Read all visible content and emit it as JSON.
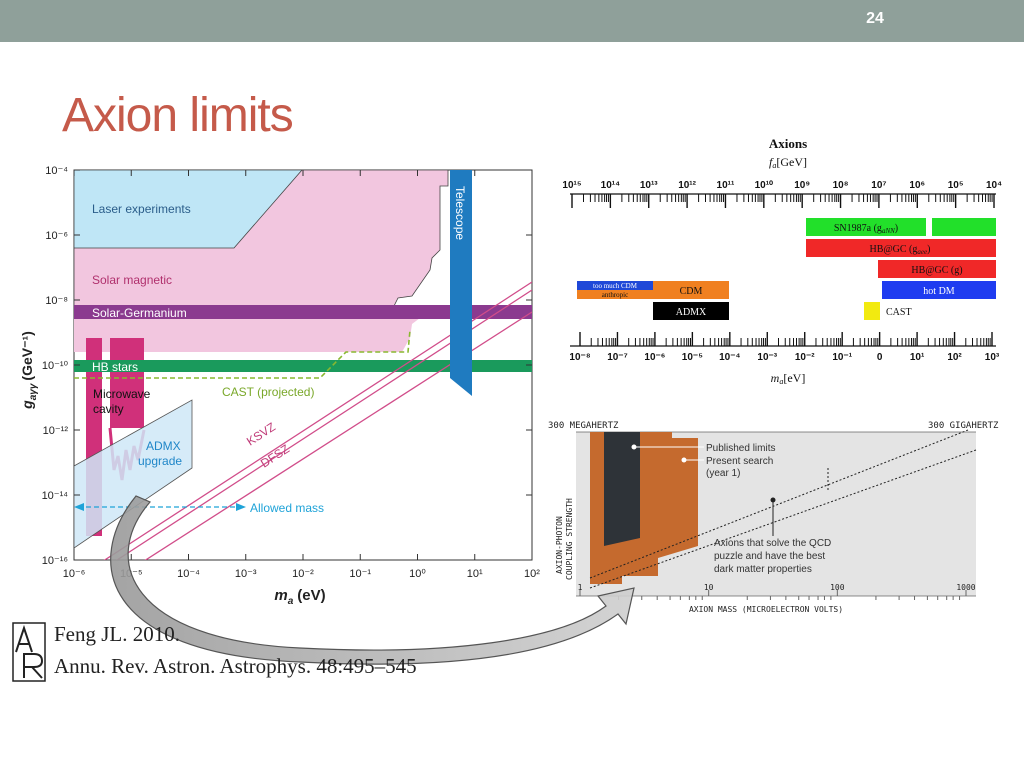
{
  "slide": {
    "number": "24",
    "title": "Axion limits"
  },
  "left_figure": {
    "ylabel": "g",
    "ylabel_sub": "aγγ",
    "ylabel_unit": "(GeV⁻¹)",
    "xlabel": "m",
    "xlabel_sub": "a",
    "xlabel_unit": "(eV)",
    "y_ticks": [
      "10⁻⁴",
      "10⁻⁶",
      "10⁻⁸",
      "10⁻¹⁰",
      "10⁻¹²",
      "10⁻¹⁴",
      "10⁻¹⁶"
    ],
    "x_ticks": [
      "10⁻⁶",
      "10⁻⁵",
      "10⁻⁴",
      "10⁻³",
      "10⁻²",
      "10⁻¹",
      "10⁰",
      "10¹",
      "10²"
    ],
    "regions": {
      "laser": "Laser experiments",
      "solar_magnetic": "Solar magnetic",
      "solar_germanium": "Solar-Germanium",
      "hb_stars": "HB stars",
      "microwave": "Microwave cavity",
      "microwave_l1": "Microwave",
      "microwave_l2": "cavity",
      "admx_l1": "ADMX",
      "admx_l2": "upgrade",
      "telescope": "Telescope",
      "cast": "CAST (projected)",
      "ksvz": "KSVZ",
      "dfsz": "DFSZ",
      "allowed": "Allowed mass"
    },
    "colors": {
      "laser": "#bfe6f6",
      "solar": "#f2c6df",
      "germanium": "#8b3a8f",
      "hb": "#1a9a5c",
      "microwave": "#d0307a",
      "telescope": "#1f7bc0",
      "cast": "#8ab830",
      "allowed": "#1fa3d8"
    }
  },
  "right_chart": {
    "title": "Axions",
    "fa_label": "f",
    "fa_sub": "a",
    "fa_unit": "[GeV]",
    "top_ticks": [
      "10¹⁵",
      "10¹⁴",
      "10¹³",
      "10¹²",
      "10¹¹",
      "10¹⁰",
      "10⁹",
      "10⁸",
      "10⁷",
      "10⁶",
      "10⁵",
      "10⁴"
    ],
    "bottom_ticks": [
      "10⁻⁸",
      "10⁻⁷",
      "10⁻⁶",
      "10⁻⁵",
      "10⁻⁴",
      "10⁻³",
      "10⁻²",
      "10⁻¹",
      "0",
      "10¹",
      "10²",
      "10³"
    ],
    "ma_label": "m",
    "ma_sub": "a",
    "ma_unit": "[eV]",
    "bars": {
      "sn1987a": "SN1987a (g",
      "sn1987a_sub": "aNN",
      "hbgc_e": "HB@GC (g",
      "hbgc_e_sub": "aee",
      "hbgc_g": "HB@GC (g)",
      "hot_dm": "hot DM",
      "cast": "CAST",
      "too_much_cdm": "too much CDM",
      "anthropic": "anthropic",
      "cdm": "CDM",
      "admx": "ADMX"
    },
    "colors": {
      "sn": "#22e02a",
      "hb": "#f02828",
      "hot": "#1f3cf0",
      "cast": "#f2ea10",
      "cdm": "#f08020",
      "admx": "#000000",
      "tmcdm": "#1f48d8"
    }
  },
  "bottom_right_chart": {
    "top_left_label": "300 MEGAHERTZ",
    "top_right_label": "300 GIGAHERTZ",
    "legend_published": "Published limits",
    "legend_present_1": "Present search",
    "legend_present_2": "(year 1)",
    "annotation_1": "Axions that solve the QCD",
    "annotation_2": "puzzle and have the best",
    "annotation_3": "dark matter properties",
    "ylabel_1": "AXION-PHOTON",
    "ylabel_2": "COUPLING STRENGTH",
    "xlabel": "AXION MASS (MICROELECTRON VOLTS)",
    "x_ticks": [
      "1",
      "10",
      "100",
      "1000"
    ],
    "colors": {
      "published": "#2e3338",
      "present": "#c56a2e",
      "bg": "#e4e4e4"
    }
  },
  "citation": {
    "line1": "Feng JL. 2010.",
    "line2": "Annu. Rev. Astron. Astrophys. 48:495–545"
  }
}
